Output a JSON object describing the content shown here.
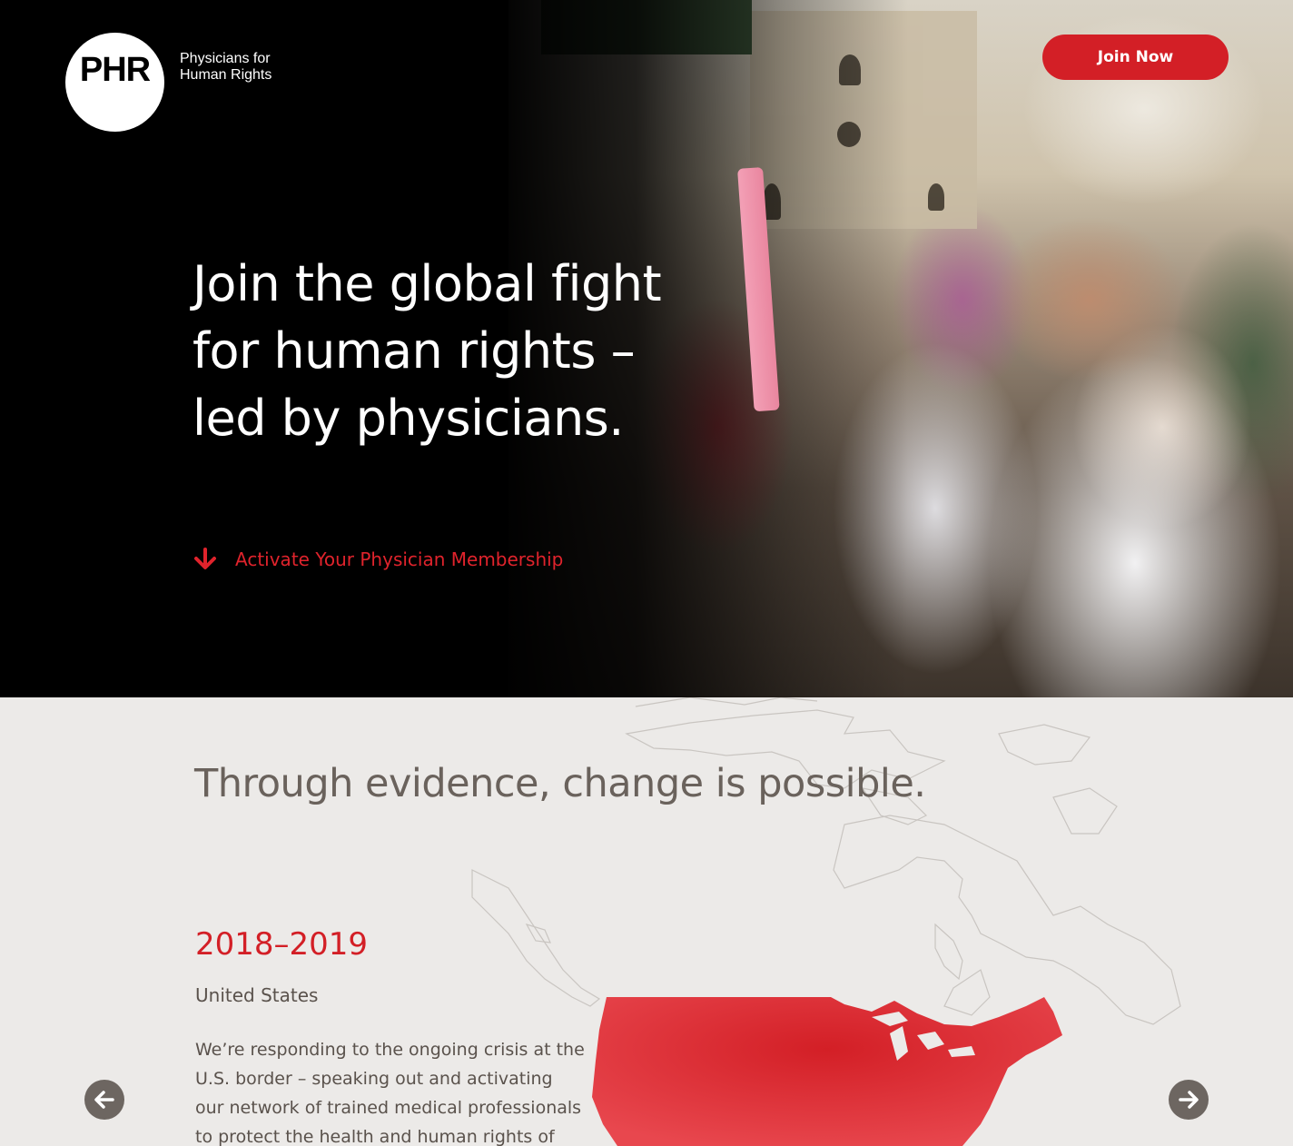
{
  "header": {
    "logo_mark": "PHR",
    "logo_line1": "Physicians for",
    "logo_line2": "Human Rights",
    "join_label": "Join Now"
  },
  "hero": {
    "heading": "Join the global fight for human rights – led by physicians.",
    "cta_label": "Activate Your Physician Membership",
    "cta_icon": "arrow-down-icon"
  },
  "evidence": {
    "title": "Through evidence, change is possible.",
    "slide": {
      "years": "2018–2019",
      "region": "United States",
      "description": "We’re responding to the ongoing crisis at the U.S. border – speaking out and activating our network of trained medical professionals to protect the health and human rights of"
    },
    "prev_icon": "arrow-left-icon",
    "next_icon": "arrow-right-icon"
  },
  "colors": {
    "brand_red": "#d31f26",
    "map_highlight": "#e2343d",
    "text_gray": "#5a524c",
    "section_bg": "#eceae8"
  }
}
